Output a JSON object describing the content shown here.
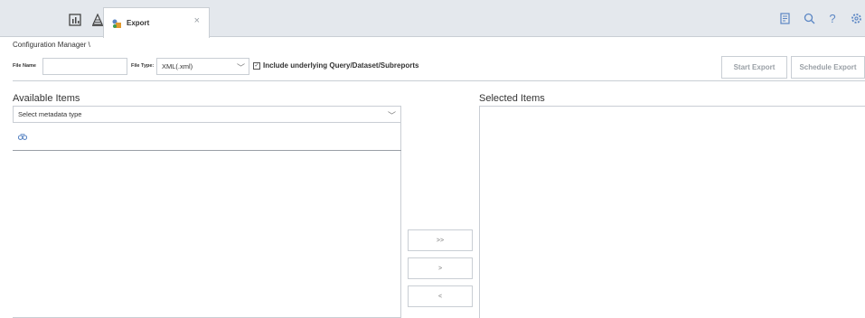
{
  "tabs": {
    "active_label": "Export",
    "close_glyph": "×"
  },
  "toolbar_icons": [
    "report-icon",
    "search-icon",
    "help-icon",
    "settings-icon"
  ],
  "breadcrumb": "Configuration Manager \\",
  "form": {
    "file_name_label": "File Name",
    "file_name_value": "",
    "file_type_label": "File Type:",
    "file_type_value": "XML(.xml)",
    "include_checked": true,
    "include_label": "Include underlying Query/Dataset/Subreports",
    "start_export_label": "Start Export",
    "schedule_export_label": "Schedule Export"
  },
  "available": {
    "title": "Available Items",
    "select_placeholder": "Select metadata type"
  },
  "selected": {
    "title": "Selected Items"
  },
  "move_buttons": {
    "add_all": ">>",
    "add": ">",
    "remove": "<"
  },
  "colors": {
    "accent": "#5b86c4",
    "tabbar_bg": "#e4e8ed",
    "border": "#c9ced4",
    "disabled_text": "#9aa0a6"
  }
}
